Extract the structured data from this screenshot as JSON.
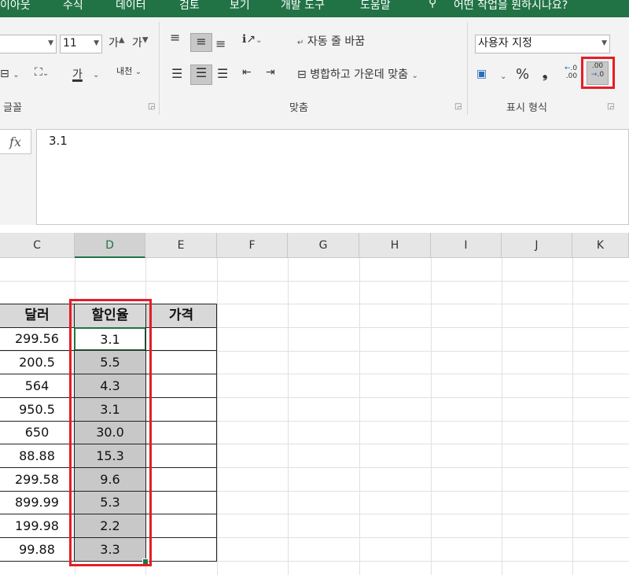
{
  "menu": {
    "items": [
      "이아웃",
      "수식",
      "데이터",
      "검토",
      "보기",
      "개발 도구",
      "도움말"
    ],
    "tell_me": "어떤 작업을 원하시나요?"
  },
  "ribbon": {
    "font": {
      "size": "11",
      "grow_icon": "가",
      "shrink_icon": "가",
      "font_color_glyph": "가",
      "phonetic_glyph": "내천",
      "group_label": "글꼴"
    },
    "alignment": {
      "wrap_text": "자동 줄 바꿈",
      "merge_center": "병합하고 가운데 맞춤",
      "group_label": "맞춤"
    },
    "number": {
      "format": "사용자 지정",
      "percent": "%",
      "comma": "❟",
      "increase_decimal_top": ".0",
      "increase_decimal_bottom": ".00",
      "decrease_decimal_top": ".00",
      "decrease_decimal_bottom": ".0",
      "group_label": "표시 형식"
    }
  },
  "formula_bar": {
    "fx": "fx",
    "value": "3.1"
  },
  "sheet": {
    "columns": [
      "C",
      "D",
      "E",
      "F",
      "G",
      "H",
      "I",
      "J",
      "K"
    ],
    "selected_column": "D",
    "headers": {
      "dollar": "달러",
      "discount": "할인율",
      "price": "가격"
    },
    "rows": [
      {
        "dollar": "299.56",
        "discount": "3.1"
      },
      {
        "dollar": "200.5",
        "discount": "5.5"
      },
      {
        "dollar": "564",
        "discount": "4.3"
      },
      {
        "dollar": "950.5",
        "discount": "3.1"
      },
      {
        "dollar": "650",
        "discount": "30.0"
      },
      {
        "dollar": "88.88",
        "discount": "15.3"
      },
      {
        "dollar": "299.58",
        "discount": "9.6"
      },
      {
        "dollar": "899.99",
        "discount": "5.3"
      },
      {
        "dollar": "199.98",
        "discount": "2.2"
      },
      {
        "dollar": "99.88",
        "discount": "3.3"
      }
    ]
  },
  "colors": {
    "excel_green": "#217346",
    "highlight_red": "#e41e26",
    "selection_gray": "#c8c8c8"
  }
}
